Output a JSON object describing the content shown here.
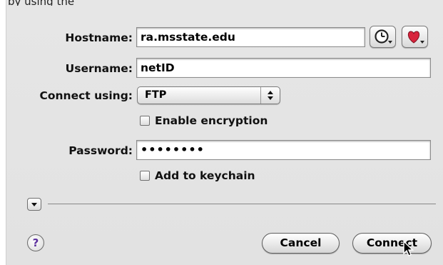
{
  "top_fragment": "by using the",
  "form": {
    "hostname_label": "Hostname:",
    "hostname_value": "ra.msstate.edu",
    "username_label": "Username:",
    "username_value": "netID",
    "connect_label": "Connect using:",
    "protocol_value": "FTP",
    "encryption_label": "Enable encryption",
    "encryption_checked": false,
    "password_label": "Password:",
    "password_value": "••••••••",
    "keychain_label": "Add to keychain",
    "keychain_checked": false
  },
  "buttons": {
    "help": "?",
    "cancel": "Cancel",
    "connect": "Connect"
  },
  "icons": {
    "history": "clock-icon",
    "favorites": "heart-icon",
    "disclosure": "triangle-down-icon",
    "cursor": "arrow-pointer-icon"
  },
  "colors": {
    "heart": "#d8243c",
    "help_glyph": "#5b2f9d"
  }
}
